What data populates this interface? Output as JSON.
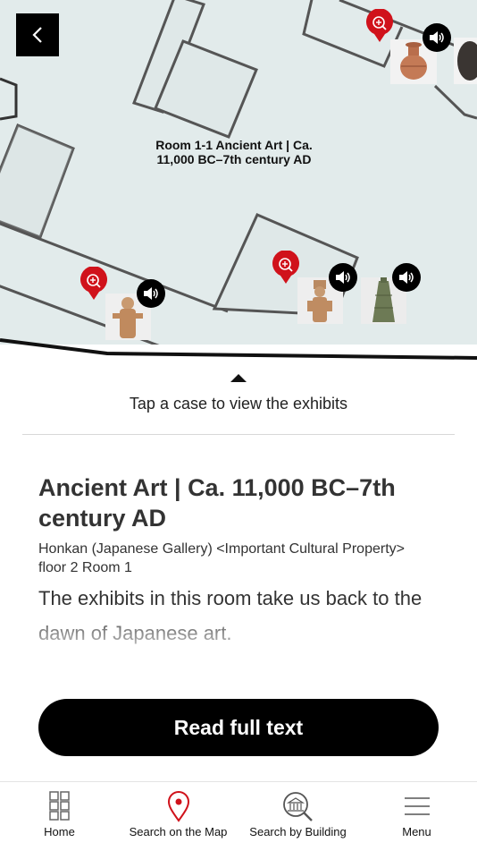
{
  "map": {
    "room_label": "Room 1-1 Ancient Art | Ca. 11,000 BC–7th century AD",
    "accent_color": "#d0121b",
    "thumbnails": [
      {
        "name": "jar-thumbnail",
        "subject": "earthenware jar"
      },
      {
        "name": "stone-thumbnail",
        "subject": "dark stone"
      },
      {
        "name": "haniwa-left-thumbnail",
        "subject": "haniwa figure"
      },
      {
        "name": "haniwa-center-thumbnail",
        "subject": "haniwa figure"
      },
      {
        "name": "bell-thumbnail",
        "subject": "bronze bell"
      }
    ]
  },
  "panel": {
    "hint": "Tap a case to view the exhibits",
    "title": "Ancient Art | Ca. 11,000 BC–7th century AD",
    "location": "Honkan (Japanese Gallery) <Important Cultural Property> floor 2 Room 1",
    "description": "The exhibits in this room take us back to the dawn of Japanese art.",
    "read_button": "Read full text"
  },
  "tabbar": {
    "items": [
      {
        "label": "Home",
        "icon": "grid-icon"
      },
      {
        "label": "Search on the Map",
        "icon": "map-pin-icon",
        "active_color": "#d0121b"
      },
      {
        "label": "Search by Building",
        "icon": "building-search-icon"
      },
      {
        "label": "Menu",
        "icon": "hamburger-icon"
      }
    ]
  }
}
